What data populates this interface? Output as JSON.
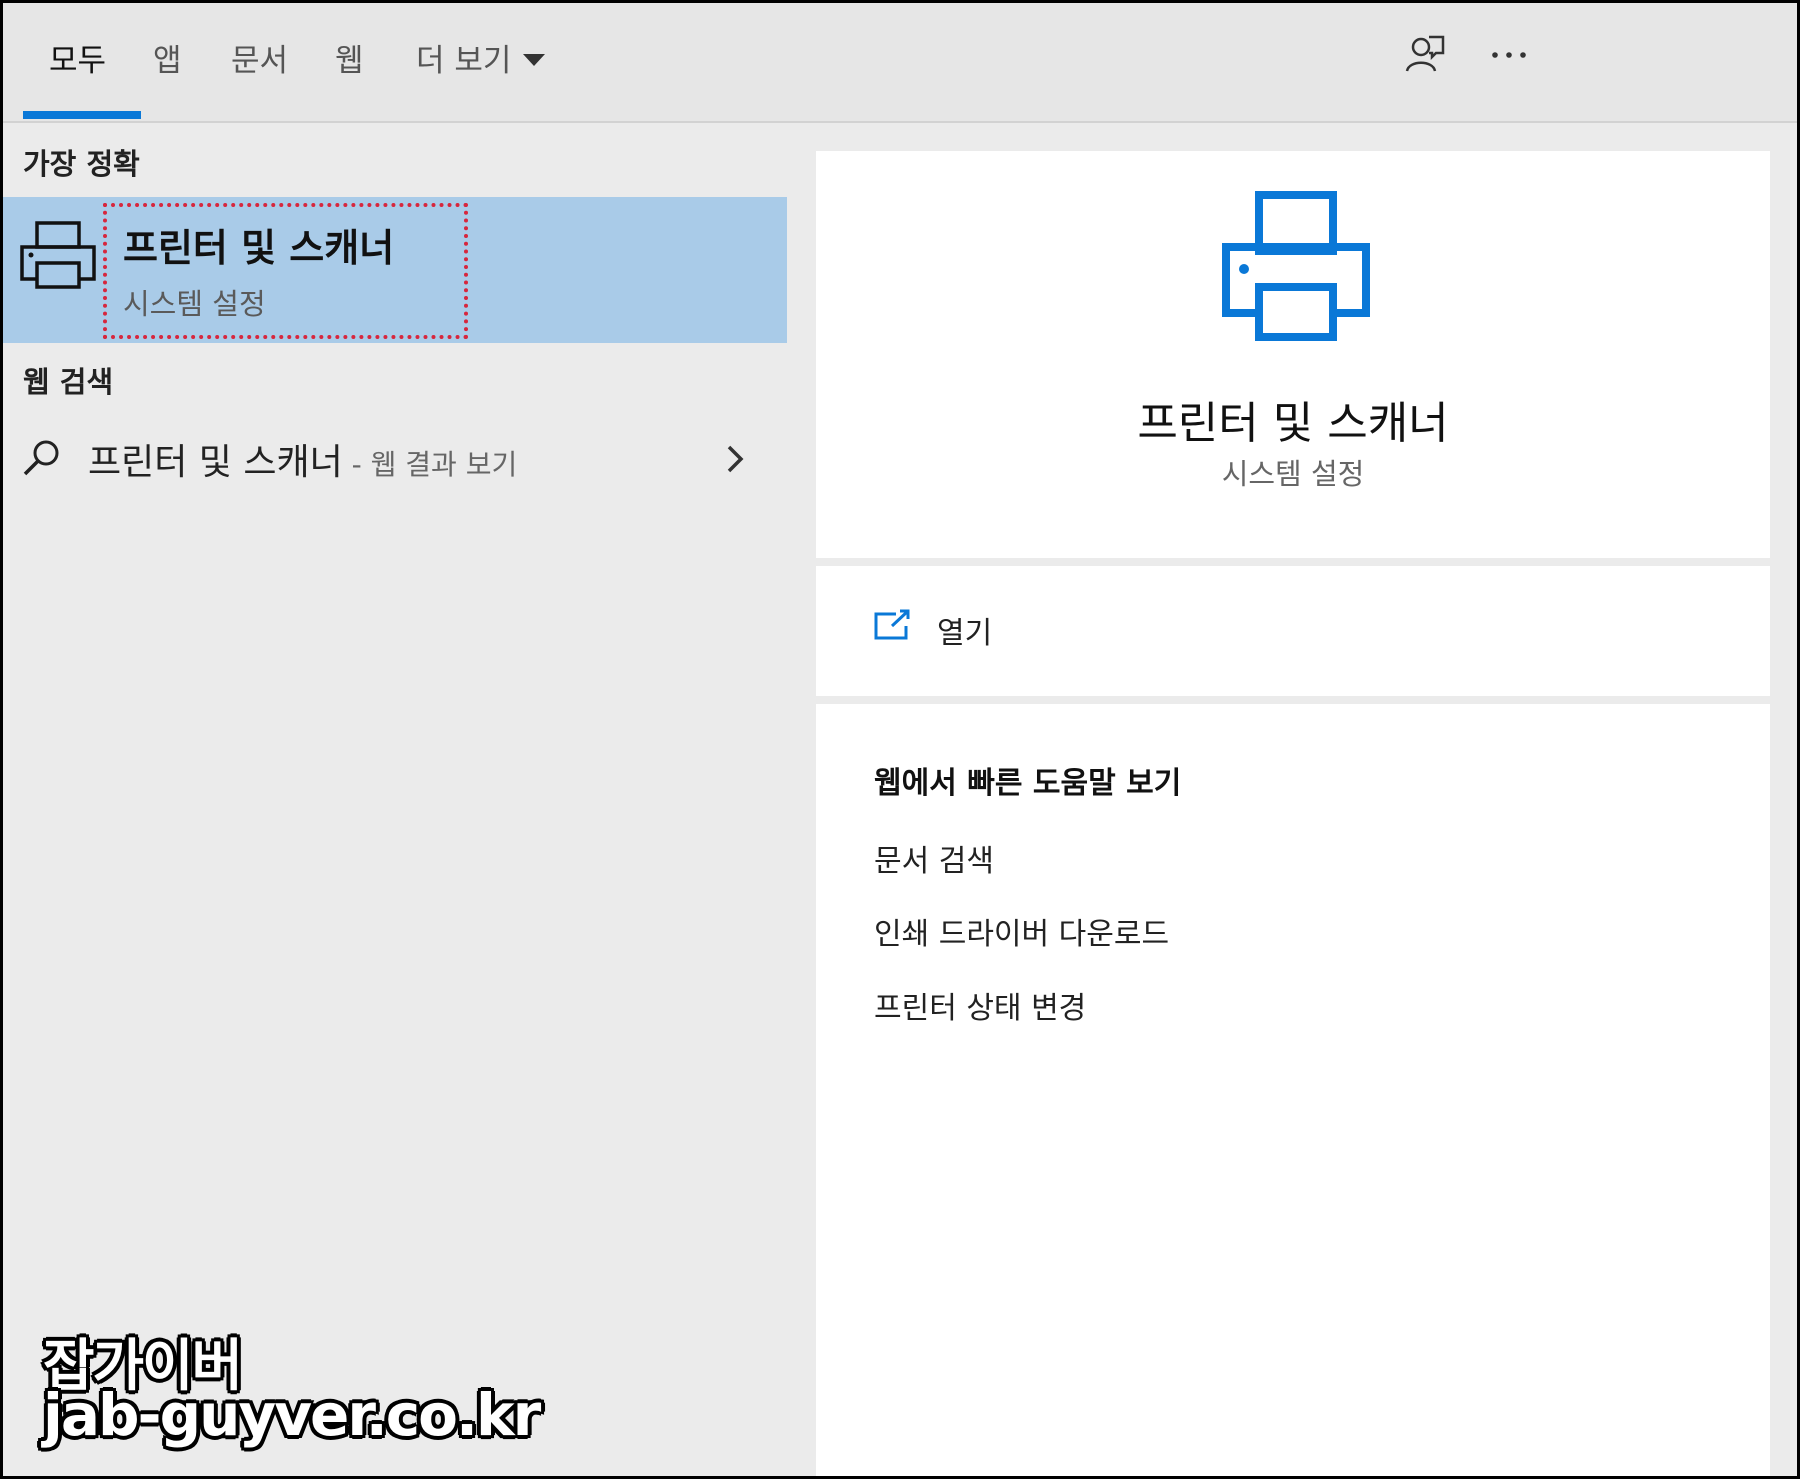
{
  "tabs": [
    {
      "label": "모두",
      "active": true
    },
    {
      "label": "앱"
    },
    {
      "label": "문서"
    },
    {
      "label": "웹"
    },
    {
      "label": "더 보기"
    }
  ],
  "top_icons": [
    "feedback-icon",
    "more-options-icon"
  ],
  "left": {
    "best_match_label": "가장 정확",
    "best_match": {
      "title": "프린터 및 스캐너",
      "subtitle": "시스템 설정",
      "icon": "printer-icon"
    },
    "web_search_label": "웹 검색",
    "web_item": {
      "text": "프린터 및 스캐너",
      "suffix": " - 웹 결과 보기",
      "icon": "search-icon"
    }
  },
  "right": {
    "hero": {
      "title": "프린터 및 스캐너",
      "subtitle": "시스템 설정",
      "icon": "printer-icon"
    },
    "open_label": "열기",
    "help_title": "웹에서 빠른 도움말 보기",
    "help_links": [
      "문서 검색",
      "인쇄 드라이버 다운로드",
      "프린터 상태 변경"
    ]
  },
  "colors": {
    "accent": "#0a78d7",
    "selection": "#a9cbe8",
    "highlight_box": "#d7263d"
  },
  "watermark": {
    "line1": "잡가이버",
    "line2": "jab-guyver.co.kr"
  }
}
